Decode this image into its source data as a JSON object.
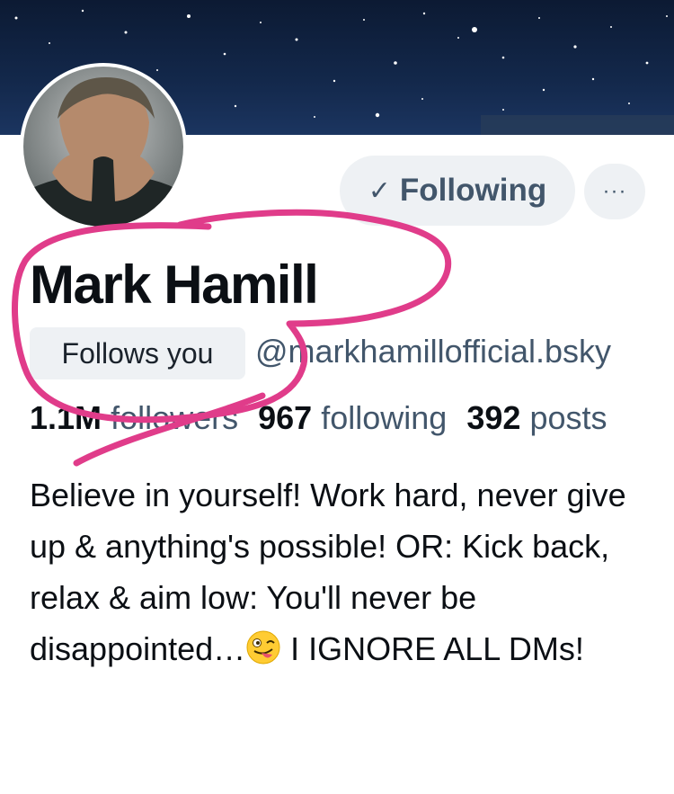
{
  "profile": {
    "display_name": "Mark Hamill",
    "follows_you_badge": "Follows you",
    "handle": "@markhamillofficial.bsky",
    "follow_button_label": "Following",
    "more_button_label": "···",
    "stats": {
      "followers_count": "1.1M",
      "followers_label": "followers",
      "following_count": "967",
      "following_label": "following",
      "posts_count": "392",
      "posts_label": "posts"
    },
    "bio_part1": "Believe in yourself! Work hard, never give up & anything's possible! OR: Kick back, relax & aim low: You'll never be disappointed…",
    "bio_part2": " I IGNORE ALL DMs!"
  },
  "icons": {
    "follow_check": "check-icon",
    "bio_emoji": "winking-face-with-tongue-emoji"
  },
  "colors": {
    "annotation": "#e03c8a",
    "button_bg": "#eef1f4",
    "muted_text": "#42566b"
  }
}
